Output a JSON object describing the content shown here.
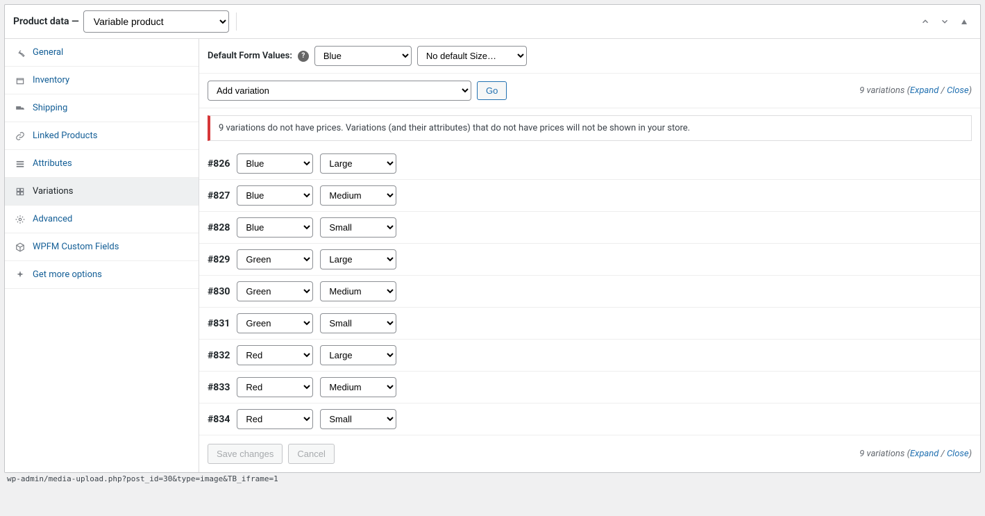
{
  "header": {
    "title": "Product data",
    "dash": "—",
    "type_select_value": "Variable product"
  },
  "sidebar": {
    "items": [
      {
        "label": "General",
        "icon": "wrench"
      },
      {
        "label": "Inventory",
        "icon": "box"
      },
      {
        "label": "Shipping",
        "icon": "truck"
      },
      {
        "label": "Linked Products",
        "icon": "link"
      },
      {
        "label": "Attributes",
        "icon": "list"
      },
      {
        "label": "Variations",
        "icon": "grid",
        "active": true
      },
      {
        "label": "Advanced",
        "icon": "gear"
      },
      {
        "label": "WPFM Custom Fields",
        "icon": "cube"
      },
      {
        "label": "Get more options",
        "icon": "sparkle"
      }
    ]
  },
  "defaults": {
    "label": "Default Form Values:",
    "color_value": "Blue",
    "size_value": "No default Size…"
  },
  "toolbar": {
    "add_variation_value": "Add variation",
    "go_label": "Go",
    "count_text": "9 variations",
    "open_paren": "(",
    "expand": "Expand",
    "slash": " / ",
    "close": "Close",
    "close_paren": ")"
  },
  "notice": "9 variations do not have prices. Variations (and their attributes) that do not have prices will not be shown in your store.",
  "variations": [
    {
      "id": "#826",
      "color": "Blue",
      "size": "Large"
    },
    {
      "id": "#827",
      "color": "Blue",
      "size": "Medium"
    },
    {
      "id": "#828",
      "color": "Blue",
      "size": "Small"
    },
    {
      "id": "#829",
      "color": "Green",
      "size": "Large"
    },
    {
      "id": "#830",
      "color": "Green",
      "size": "Medium"
    },
    {
      "id": "#831",
      "color": "Green",
      "size": "Small"
    },
    {
      "id": "#832",
      "color": "Red",
      "size": "Large"
    },
    {
      "id": "#833",
      "color": "Red",
      "size": "Medium"
    },
    {
      "id": "#834",
      "color": "Red",
      "size": "Small"
    }
  ],
  "footer": {
    "save_label": "Save changes",
    "cancel_label": "Cancel"
  },
  "status_bar": "wp-admin/media-upload.php?post_id=30&type=image&TB_iframe=1"
}
